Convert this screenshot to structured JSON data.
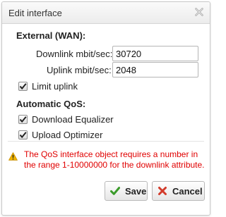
{
  "dialog": {
    "title": "Edit interface",
    "close_icon": "close-x-icon"
  },
  "external": {
    "heading": "External (WAN):",
    "downlink_label": "Downlink mbit/sec:",
    "downlink_value": "30720",
    "uplink_label": "Uplink mbit/sec:",
    "uplink_value": "2048",
    "limit_uplink_label": "Limit uplink",
    "limit_uplink_checked": true
  },
  "qos": {
    "heading": "Automatic QoS:",
    "download_equalizer_label": "Download Equalizer",
    "download_equalizer_checked": true,
    "upload_optimizer_label": "Upload Optimizer",
    "upload_optimizer_checked": true
  },
  "error": {
    "icon": "warning-triangle-icon",
    "message": "The QoS interface object requires a number in the range 1-10000000 for the downlink attribute.",
    "color": "#e00000"
  },
  "buttons": {
    "save_label": "Save",
    "save_icon": "check-icon",
    "cancel_label": "Cancel",
    "cancel_icon": "x-icon"
  },
  "colors": {
    "check_green": "#3a9b2a",
    "cancel_red": "#d23a2a"
  }
}
